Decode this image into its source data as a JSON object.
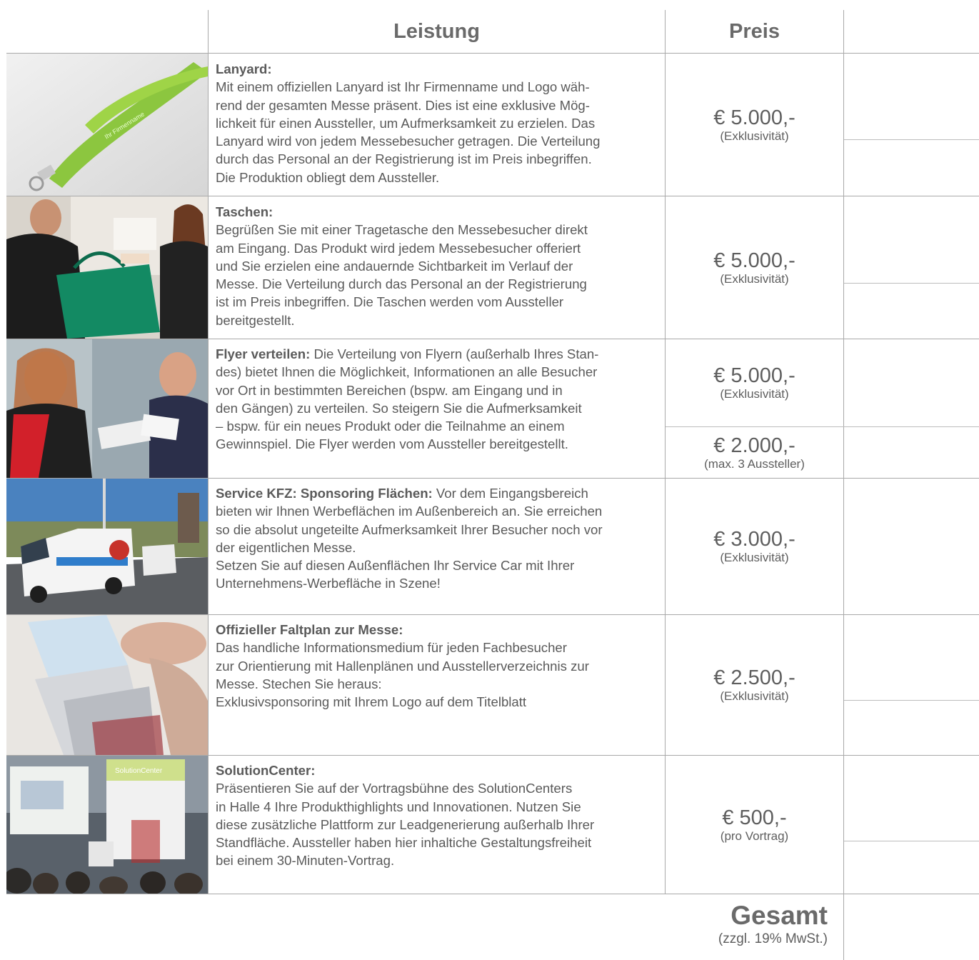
{
  "header": {
    "service_label": "Leistung",
    "price_label": "Preis"
  },
  "rows": [
    {
      "title": "Lanyard:",
      "lines": [
        "Mit einem offiziellen Lanyard ist Ihr Firmenname und Logo wäh-",
        "rend der gesamten Messe präsent. Dies ist eine exklusive Mög-",
        "lichkeit für einen Aussteller, um Aufmerksamkeit zu erzielen. Das",
        "Lanyard wird von jedem Messebesucher getragen. Die Verteilung",
        "durch das Personal an der Registrierung ist im Preis inbegriffen.",
        "Die Produktion obliegt dem Aussteller."
      ],
      "prices": [
        {
          "value": "€ 5.000,-",
          "note": "(Exklusivität)"
        }
      ],
      "photo_text": "Ihr Firmenname"
    },
    {
      "title": "Taschen:",
      "lines": [
        "Begrüßen Sie mit einer Tragetasche den Messebesucher direkt",
        "am Eingang. Das Produkt wird jedem Messebesucher offeriert",
        "und Sie erzielen eine andauernde Sichtbarkeit im Verlauf der",
        "Messe. Die Verteilung durch das Personal an der Registrierung",
        "ist im Preis inbegriffen. Die Taschen werden vom Aussteller",
        "bereitgestellt."
      ],
      "prices": [
        {
          "value": "€ 5.000,-",
          "note": "(Exklusivität)"
        }
      ]
    },
    {
      "title": "Flyer verteilen:",
      "first_line_rest": " Die Verteilung von Flyern (außerhalb Ihres Stan-",
      "lines": [
        "des) bietet Ihnen die Möglichkeit, Informationen an alle Besucher",
        "vor Ort in bestimmten  Bereichen (bspw. am Eingang und in",
        "den Gängen) zu verteilen. So steigern Sie die Aufmerksamkeit",
        "– bspw. für ein neues Produkt oder die Teilnahme an einem",
        "Gewinnspiel. Die Flyer werden vom Aussteller bereitgestellt."
      ],
      "prices": [
        {
          "value": "€ 5.000,-",
          "note": "(Exklusivität)"
        },
        {
          "value": "€ 2.000,-",
          "note": "(max. 3 Aussteller)"
        }
      ]
    },
    {
      "title": "Service KFZ: Sponsoring Flächen:",
      "first_line_rest": " Vor dem Eingangsbereich",
      "lines": [
        "bieten wir Ihnen Werbeflächen im Außenbereich an. Sie erreichen",
        "so die absolut ungeteilte Aufmerksamkeit Ihrer Besucher noch vor",
        "der eigentlichen Messe.",
        "Setzen Sie auf diesen Außenflächen Ihr Service Car mit Ihrer",
        "Unternehmens-Werbefläche in Szene!"
      ],
      "prices": [
        {
          "value": "€ 3.000,-",
          "note": "(Exklusivität)"
        }
      ]
    },
    {
      "title": "Offizieller Faltplan zur Messe:",
      "lines": [
        "Das handliche Informationsmedium für jeden Fachbesucher",
        "zur Orientierung mit Hallenplänen und Ausstellerverzeichnis zur",
        "Messe. Stechen Sie heraus:",
        "Exklusivsponsoring mit Ihrem Logo auf dem Titelblatt"
      ],
      "prices": [
        {
          "value": "€ 2.500,-",
          "note": "(Exklusivität)"
        }
      ]
    },
    {
      "title": "SolutionCenter:",
      "lines": [
        "Präsentieren Sie auf der Vortragsbühne des SolutionCenters",
        "in Halle 4 Ihre Produkthighlights und Innovationen. Nutzen Sie",
        "diese zusätzliche Plattform zur Leadgenerierung außerhalb Ihrer",
        "Standfläche. Aussteller haben hier inhaltiche Gestaltungsfreiheit",
        "bei einem 30-Minuten-Vortrag."
      ],
      "prices": [
        {
          "value": "€ 500,-",
          "note": "(pro Vortrag)"
        }
      ],
      "photo_text": "SolutionCenter"
    }
  ],
  "total": {
    "label": "Gesamt",
    "note": "(zzgl. 19% MwSt.)"
  }
}
